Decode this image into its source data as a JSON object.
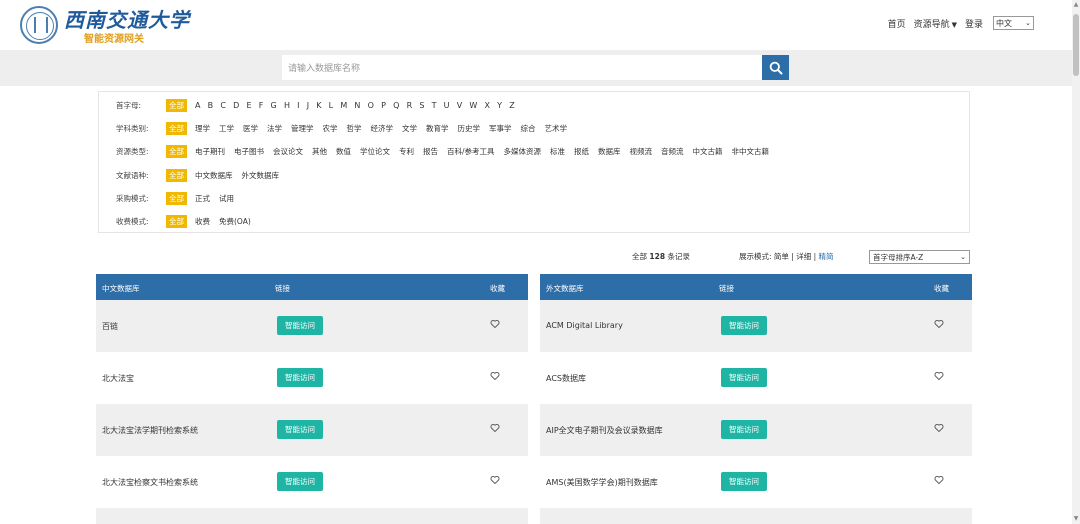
{
  "header": {
    "logo_title": "西南交通大学",
    "logo_subtitle": "智能资源网关",
    "nav": [
      "首页",
      "资源导航",
      "登录"
    ],
    "language": "中文"
  },
  "search": {
    "placeholder": "请输入数据库名称"
  },
  "filters": [
    {
      "label": "首字母:",
      "options": [
        "全部",
        "A",
        "B",
        "C",
        "D",
        "E",
        "F",
        "G",
        "H",
        "I",
        "J",
        "K",
        "L",
        "M",
        "N",
        "O",
        "P",
        "Q",
        "R",
        "S",
        "T",
        "U",
        "V",
        "W",
        "X",
        "Y",
        "Z"
      ]
    },
    {
      "label": "学科类别:",
      "options": [
        "全部",
        "理学",
        "工学",
        "医学",
        "法学",
        "管理学",
        "农学",
        "哲学",
        "经济学",
        "文学",
        "教育学",
        "历史学",
        "军事学",
        "综合",
        "艺术学"
      ]
    },
    {
      "label": "资源类型:",
      "options": [
        "全部",
        "电子期刊",
        "电子图书",
        "会议论文",
        "其他",
        "数值",
        "学位论文",
        "专利",
        "报告",
        "百科/参考工具",
        "多媒体资源",
        "标准",
        "报纸",
        "数据库",
        "视频流",
        "音频流",
        "中文古籍",
        "非中文古籍"
      ]
    },
    {
      "label": "文献语种:",
      "options": [
        "全部",
        "中文数据库",
        "外文数据库"
      ]
    },
    {
      "label": "采购模式:",
      "options": [
        "全部",
        "正式",
        "试用"
      ]
    },
    {
      "label": "收费模式:",
      "options": [
        "全部",
        "收费",
        "免费(OA)"
      ]
    }
  ],
  "records": {
    "prefix": "全部",
    "count": "128",
    "suffix": "条记录"
  },
  "display_mode": {
    "label": "展示模式:",
    "simple": "简单",
    "sep1": " | ",
    "detail": "详细",
    "sep2": " | ",
    "brief": "精简"
  },
  "sort": {
    "value": "首字母排序A-Z"
  },
  "tables": [
    {
      "headers": {
        "name": "中文数据库",
        "link": "链接",
        "fav": "收藏"
      },
      "rows": [
        {
          "name": "百链",
          "button": "智能访问"
        },
        {
          "name": "北大法宝",
          "button": "智能访问"
        },
        {
          "name": "北大法宝法学期刊检索系统",
          "button": "智能访问"
        },
        {
          "name": "北大法宝检察文书检索系统",
          "button": "智能访问"
        }
      ]
    },
    {
      "headers": {
        "name": "外文数据库",
        "link": "链接",
        "fav": "收藏"
      },
      "rows": [
        {
          "name": "ACM Digital Library",
          "button": "智能访问"
        },
        {
          "name": "ACS数据库",
          "button": "智能访问"
        },
        {
          "name": "AIP全文电子期刊及会议录数据库",
          "button": "智能访问"
        },
        {
          "name": "AMS(美国数学学会)期刊数据库",
          "button": "智能访问"
        }
      ]
    }
  ],
  "colors": {
    "primary": "#2d6da8",
    "accent": "#f0b800",
    "button": "#1fb5a5"
  },
  "icons": {
    "search": "search-icon",
    "favorite": "heart-outline-icon"
  }
}
